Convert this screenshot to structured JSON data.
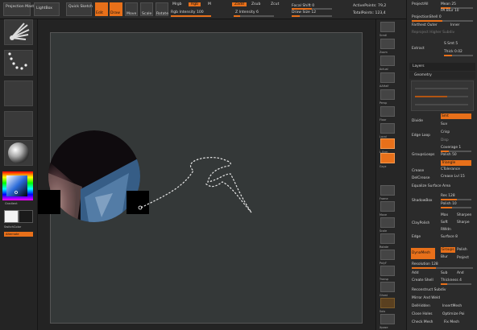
{
  "toolbar": {
    "projection_master": "Projection Master",
    "lightbox": "LightBox",
    "quick_sketch": "Quick Sketch",
    "edit": "Edit",
    "draw": "Draw",
    "move": "Move",
    "scale": "Scale",
    "rotate": "Rotate",
    "mrgb": "Mrgb",
    "rgb": "Rgb",
    "m": "M",
    "rgb_intensity": "Rgb Intensity 100",
    "zadd": "Zadd",
    "zsub": "Zsub",
    "zcut": "Zcut",
    "z_intensity": "Z Intensity 6",
    "focal_shift": "Focal Shift 0",
    "draw_size": "Draw Size 12",
    "active_points": "ActivePoints: 79,2",
    "total_points": "TotalPoints: 123,4"
  },
  "left": {
    "gradient": "Gradient",
    "switch_color": "SwitchColor",
    "alternate": "Alternate"
  },
  "midcol": {
    "labels": [
      "Scroll",
      "Zoom",
      "Actual",
      "AAHalf",
      "Persp",
      "Floor",
      "Local",
      "L.Sym",
      "Gxyz",
      "Frame",
      "Move",
      "Scale",
      "Rotate",
      "PolyF",
      "Transp",
      "Ghost",
      "Solo",
      "Xpose"
    ]
  },
  "right": {
    "project_all": "ProjectAll",
    "dist": "Dist 0.",
    "mean": "Mean 25",
    "pa_blur": "PA Blur 10",
    "project_bas": "ProjectionShell 0",
    "farthest_outer": "Farthest Outer",
    "inner": "Inner",
    "reproject": "Reproject Higher Subdiv",
    "extract": "Extract",
    "s_smt": "S Smt 5",
    "e_smt": "E Smt 5",
    "thick": "Thick 0.02",
    "layers": "Layers",
    "geometry": "Geometry",
    "divide": "Divide",
    "smt": "Smt",
    "suv": "Suv",
    "edge_loop": "Edge Loop",
    "crisp": "Crisp",
    "disp": "Disp",
    "coverage": "Coverage 1",
    "dbl": "Dbl",
    "groups_loops": "GroupsLoops",
    "polish": "Polish 50",
    "triangle": "Triangle",
    "crease": "Crease",
    "c_tolerance": "CTolerance",
    "del_crease": "DelCrease",
    "crease_lvl": "Crease Lvl 15",
    "equalize": "Equalize Surface Area",
    "shadow_box": "ShadowBox",
    "res": "Res 128",
    "polish2": "Polish 10",
    "clay_polish": "ClayPolish",
    "max": "Max",
    "sharpen": "Sharpen",
    "soft": "Soft",
    "sharpe": "Sharpe",
    "rwdn": "RWdn",
    "edge_alt": "Edge",
    "surface": "Surface 8",
    "dynamesh": "DynaMesh",
    "groups": "Groups",
    "polish3": "Polish",
    "blur": "Blur",
    "project": "Project",
    "resolution": "Resolution 128",
    "add": "Add",
    "sub": "Sub",
    "and": "And",
    "create_shell": "Create Shell",
    "thickness": "Thickness 4",
    "reconstruct": "Reconstruct Subdiv",
    "mirror_weld": "Mirror And Weld",
    "delhidden": "DelHidden",
    "insert_mesh": "InsertMesh",
    "close_holes": "Close Holes",
    "optimize": "Optimize Poi",
    "check_mesh": "Check Mesh",
    "fix_mesh": "Fix Mesh"
  },
  "colors": {
    "accent": "#e8701a",
    "canvas": "#343838",
    "panel": "#2b2b2b"
  }
}
